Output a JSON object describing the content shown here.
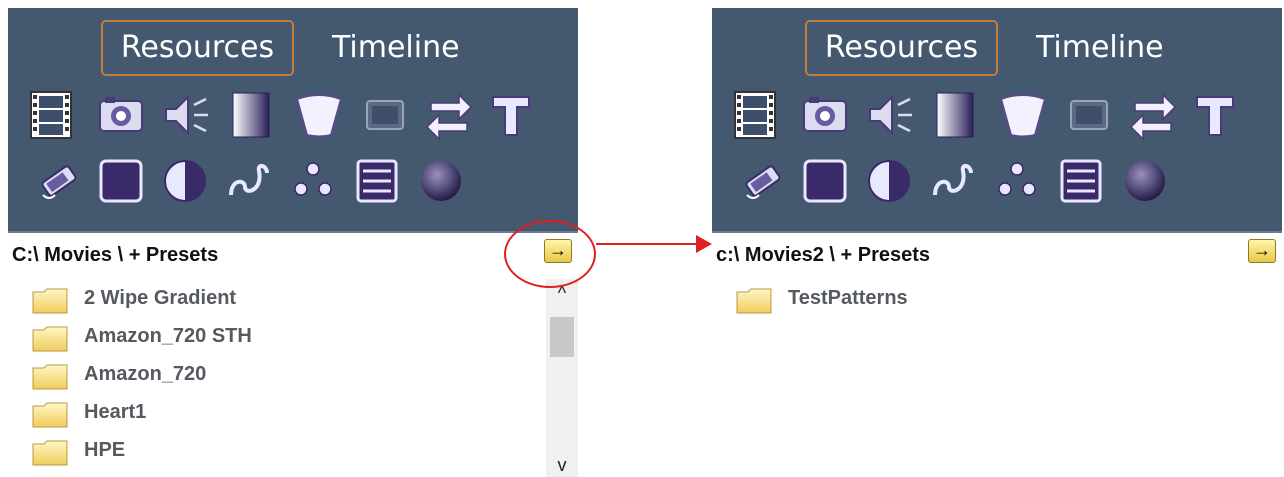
{
  "colors": {
    "panel_bg": "#44586f",
    "tab_border": "#c57a3a",
    "icon_purple": "#5a4a8a",
    "annotation_red": "#e02020"
  },
  "tabs": {
    "resources": "Resources",
    "timeline": "Timeline"
  },
  "icons_row1": [
    "film-icon",
    "camera-icon",
    "audio-icon",
    "gradient-icon",
    "wedge-icon",
    "monitor-icon",
    "swap-icon",
    "text-icon"
  ],
  "icons_row2": [
    "effects-icon",
    "square-icon",
    "contrast-icon",
    "wave-icon",
    "dots-icon",
    "list-icon",
    "sphere-icon"
  ],
  "left": {
    "path": "C:\\ Movies \\  + Presets",
    "go": "→",
    "items": [
      "2 Wipe Gradient",
      "Amazon_720 STH",
      "Amazon_720",
      "Heart1",
      "HPE"
    ],
    "scroll_up": "^",
    "scroll_down": "v"
  },
  "right": {
    "path": "c:\\ Movies2 \\  + Presets",
    "go": "→",
    "items": [
      "TestPatterns"
    ]
  }
}
